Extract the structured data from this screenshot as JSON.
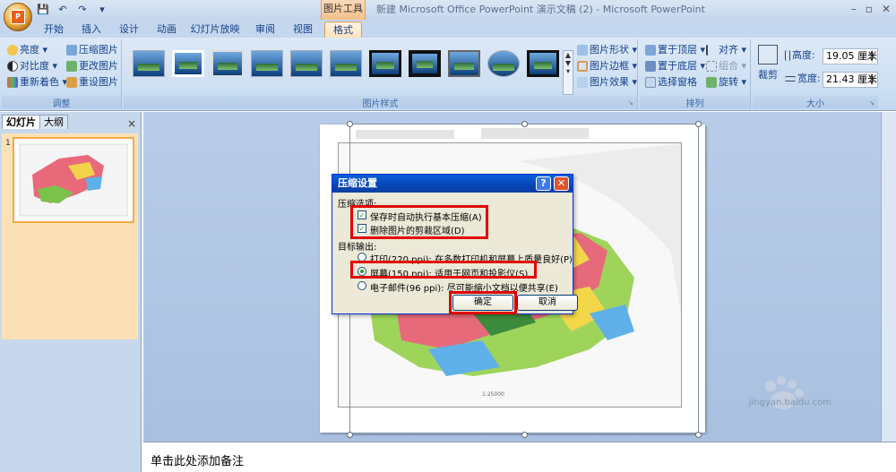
{
  "titlebar": {
    "context_tab_title": "图片工具",
    "window_title": "新建 Microsoft Office PowerPoint 演示文稿 (2) - Microsoft PowerPoint",
    "minimize": "–",
    "restore": "▫",
    "close": "✕"
  },
  "qat": {
    "save": "💾",
    "undo": "↶",
    "redo": "↷",
    "more": "▾"
  },
  "tabs": [
    "开始",
    "插入",
    "设计",
    "动画",
    "幻灯片放映",
    "审阅",
    "视图",
    "格式"
  ],
  "ribbon": {
    "adjust": {
      "label": "调整",
      "items": [
        "亮度 ▾",
        "对比度 ▾",
        "重新着色 ▾",
        "压缩图片",
        "更改图片",
        "重设图片"
      ]
    },
    "picture_styles": {
      "label": "图片样式",
      "side_items": [
        "图片形状 ▾",
        "图片边框 ▾",
        "图片效果 ▾"
      ]
    },
    "arrange": {
      "label": "排列",
      "items": [
        "置于顶层 ▾",
        "置于底层 ▾",
        "选择窗格",
        "对齐 ▾",
        "组合 ▾",
        "旋转 ▾"
      ]
    },
    "size": {
      "label": "大小",
      "crop": "裁剪",
      "height_label": "高度:",
      "height_value": "19.05 厘米",
      "width_label": "宽度:",
      "width_value": "21.43 厘米"
    }
  },
  "left_pane": {
    "tab_slides": "幻灯片",
    "tab_outline": "大纲",
    "close": "×",
    "slide_number": "1"
  },
  "dialog": {
    "title": "压缩设置",
    "help": "?",
    "close": "✕",
    "section_options": "压缩选项:",
    "option_auto_compress": "保存时自动执行基本压缩(A)",
    "option_delete_crop": "删除图片的剪裁区域(D)",
    "section_target": "目标输出:",
    "target_print": "打印(220 ppi): 在多数打印机和屏幕上质量良好(P)",
    "target_screen": "屏幕(150 ppi): 适用于网页和投影仪(S)",
    "target_email": "电子邮件(96 ppi): 尽可能缩小文档以便共享(E)",
    "ok": "确定",
    "cancel": "取消",
    "checks": {
      "auto_compress": true,
      "delete_crop": true
    },
    "selected_target": "screen"
  },
  "notes": {
    "placeholder": "单击此处添加备注"
  },
  "watermark": {
    "brand": "Bai du 经验",
    "url": "jingyan.baidu.com"
  },
  "colors": {
    "accent_red": "#e00000",
    "ribbon_blue": "#15428b",
    "xp_title_blue": "#0a5fd8"
  }
}
